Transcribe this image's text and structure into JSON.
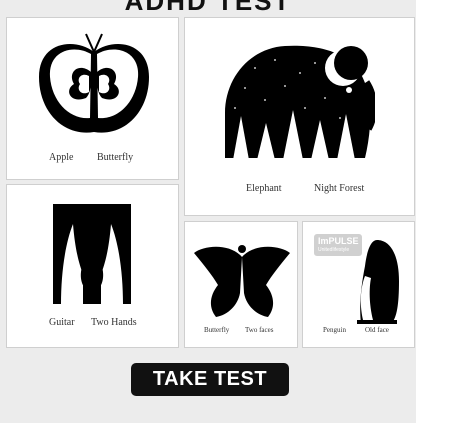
{
  "header": {
    "title": "ADHD TEST"
  },
  "cards": [
    {
      "caption_left": "Apple",
      "caption_right": "Butterfly"
    },
    {
      "caption_left": "Elephant",
      "caption_right": "Night Forest"
    },
    {
      "caption_left": "Guitar",
      "caption_right": "Two Hands"
    },
    {
      "caption_left": "Butterfly",
      "caption_right": "Two faces"
    },
    {
      "caption_left": "Penguin",
      "caption_right": "Old face",
      "badge_title": "ImPULSE",
      "badge_sub": "Unitedlifestyle"
    }
  ],
  "button": {
    "label": "TAKE TEST"
  },
  "colors": {
    "panel_bg": "#ececec",
    "card_bg": "#ffffff",
    "ink": "#000000",
    "button_bg": "#111111",
    "button_text": "#ffffff"
  }
}
